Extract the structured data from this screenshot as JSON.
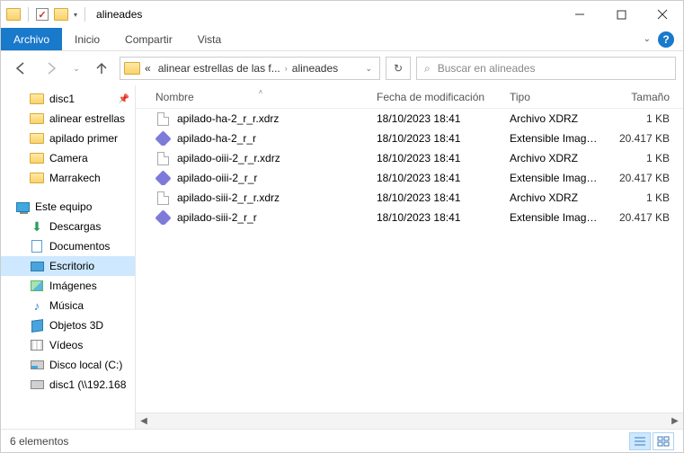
{
  "window": {
    "title": "alineades"
  },
  "ribbon": {
    "file": "Archivo",
    "tabs": [
      "Inicio",
      "Compartir",
      "Vista"
    ]
  },
  "nav": {
    "crumbs": [
      "alinear estrellas de las f...",
      "alineades"
    ],
    "search_placeholder": "Buscar en alineades"
  },
  "tree": {
    "quick": [
      {
        "label": "disc1",
        "icon": "folder",
        "pinned": true
      },
      {
        "label": "alinear estrellas",
        "icon": "folder"
      },
      {
        "label": "apilado primer",
        "icon": "folder"
      },
      {
        "label": "Camera",
        "icon": "folder"
      },
      {
        "label": "Marrakech",
        "icon": "folder"
      }
    ],
    "pc_label": "Este equipo",
    "pc": [
      {
        "label": "Descargas",
        "icon": "dl"
      },
      {
        "label": "Documentos",
        "icon": "doc"
      },
      {
        "label": "Escritorio",
        "icon": "desk",
        "selected": true
      },
      {
        "label": "Imágenes",
        "icon": "img"
      },
      {
        "label": "Música",
        "icon": "mus"
      },
      {
        "label": "Objetos 3D",
        "icon": "3d"
      },
      {
        "label": "Vídeos",
        "icon": "vid"
      },
      {
        "label": "Disco local (C:)",
        "icon": "disk"
      },
      {
        "label": "disc1 (\\\\192.168",
        "icon": "net"
      }
    ]
  },
  "columns": {
    "name": "Nombre",
    "date": "Fecha de modificación",
    "type": "Tipo",
    "size": "Tamaño"
  },
  "files": [
    {
      "name": "apilado-ha-2_r_r.xdrz",
      "date": "18/10/2023 18:41",
      "type": "Archivo XDRZ",
      "size": "1 KB",
      "icon": "file"
    },
    {
      "name": "apilado-ha-2_r_r",
      "date": "18/10/2023 18:41",
      "type": "Extensible Image ...",
      "size": "20.417 KB",
      "icon": "xisf"
    },
    {
      "name": "apilado-oiii-2_r_r.xdrz",
      "date": "18/10/2023 18:41",
      "type": "Archivo XDRZ",
      "size": "1 KB",
      "icon": "file"
    },
    {
      "name": "apilado-oiii-2_r_r",
      "date": "18/10/2023 18:41",
      "type": "Extensible Image ...",
      "size": "20.417 KB",
      "icon": "xisf"
    },
    {
      "name": "apilado-siii-2_r_r.xdrz",
      "date": "18/10/2023 18:41",
      "type": "Archivo XDRZ",
      "size": "1 KB",
      "icon": "file"
    },
    {
      "name": "apilado-siii-2_r_r",
      "date": "18/10/2023 18:41",
      "type": "Extensible Image ...",
      "size": "20.417 KB",
      "icon": "xisf"
    }
  ],
  "status": {
    "count": "6 elementos"
  }
}
